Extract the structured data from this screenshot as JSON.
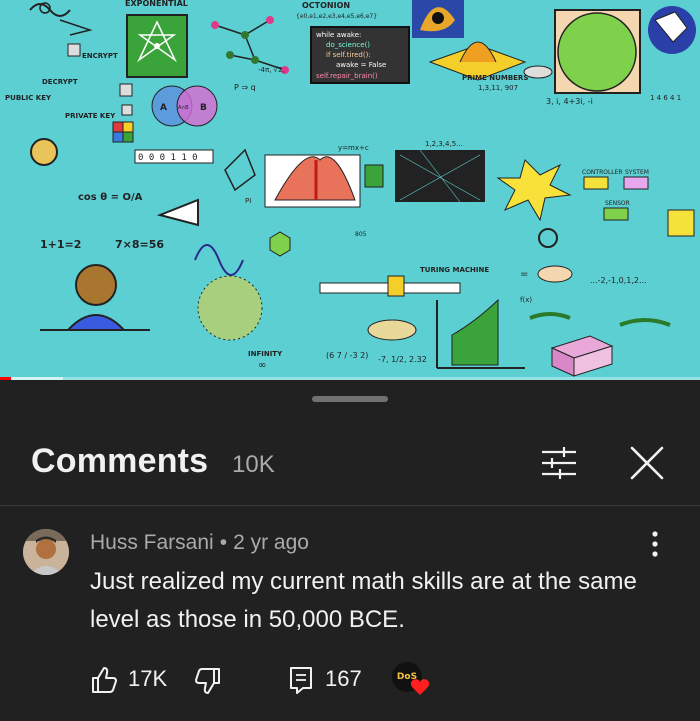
{
  "video": {
    "doodles": {
      "exponential": "EXPONENTIAL",
      "octonion": "OCTONION",
      "octonion_basis": "{e0,e1,e2,e3,e4,e5,e6,e7}",
      "code_lines": [
        "while awake:",
        "do_science()",
        "if self.tired():",
        "awake = False",
        "self.repair_brain()"
      ],
      "encrypt": "ENCRYPT",
      "decrypt": "DECRYPT",
      "public_key": "PUBLIC KEY",
      "private_key": "PRIVATE KEY",
      "set_a": "A",
      "set_b": "B",
      "set_ab": "A∩B",
      "prime_numbers": "PRIME NUMBERS",
      "primes_list": "1,3,11, 907",
      "binary": "0 0 0 1 1 0",
      "complex_seq": "3, i, 4+3i, -i",
      "numbers_14641": "1 4 6 4 1",
      "ymx": "y=mx+c",
      "counting": "1,2,3,4,5...",
      "cos_eq": "cos θ = O/A",
      "one_plus_one": "1+1=2",
      "seven_times_eight": "7×8=56",
      "pi": "PI",
      "turing": "TURING MACHINE",
      "infinity": "INFINITY",
      "integers": "...-2,-1,0,1,2...",
      "rationals": "-7, 1/2, 2.32",
      "fx": "f(x)",
      "controller": "CONTROLLER",
      "system": "SYSTEM",
      "sensor": "SENSOR",
      "p_implies_q": "P ⇒ q",
      "matrix": "(6 7 / -3 2)",
      "minus_pi": "-4π, √2,"
    },
    "progress_fraction": 0.016,
    "buffered_fraction": 0.09
  },
  "comments_panel": {
    "title": "Comments",
    "count": "10K",
    "filter_icon": "tune-icon",
    "close_icon": "close-icon"
  },
  "comment": {
    "author": "Huss Farsani",
    "separator": "•",
    "time": "2 yr ago",
    "text": "Just realized my current math skills are at the same level as those in 50,000 BCE.",
    "likes": "17K",
    "replies": "167",
    "creator_badge": "DoS"
  },
  "colors": {
    "sheet_bg": "#212121",
    "video_bg": "#5ccfd3",
    "heart": "#ff0000",
    "progress": "#ff0000"
  }
}
